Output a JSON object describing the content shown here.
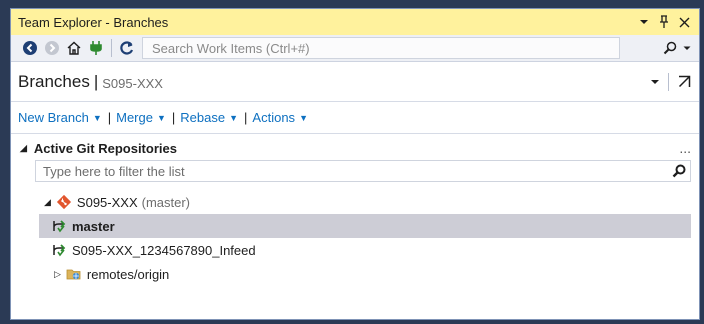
{
  "window": {
    "title": "Team Explorer - Branches"
  },
  "toolbar": {
    "search_placeholder": "Search Work Items (Ctrl+#)"
  },
  "header": {
    "title": "Branches",
    "separator": "|",
    "subtitle": "S095-XXX"
  },
  "actions": [
    {
      "label": "New Branch"
    },
    {
      "label": "Merge"
    },
    {
      "label": "Rebase"
    },
    {
      "label": "Actions"
    }
  ],
  "section": {
    "title": "Active Git Repositories",
    "more": "..."
  },
  "filter": {
    "placeholder": "Type here to filter the list"
  },
  "tree": {
    "repo": {
      "name": "S095-XXX",
      "current_branch": "(master)"
    },
    "branches": [
      {
        "name": "master",
        "selected": true
      },
      {
        "name": "S095-XXX_1234567890_Infeed",
        "selected": false
      }
    ],
    "remotes": {
      "name": "remotes/origin"
    }
  },
  "colors": {
    "titlebar_bg": "#fff29d",
    "link": "#0e70c0",
    "selection": "#cdcdd6",
    "git_accent": "#e2562e"
  }
}
